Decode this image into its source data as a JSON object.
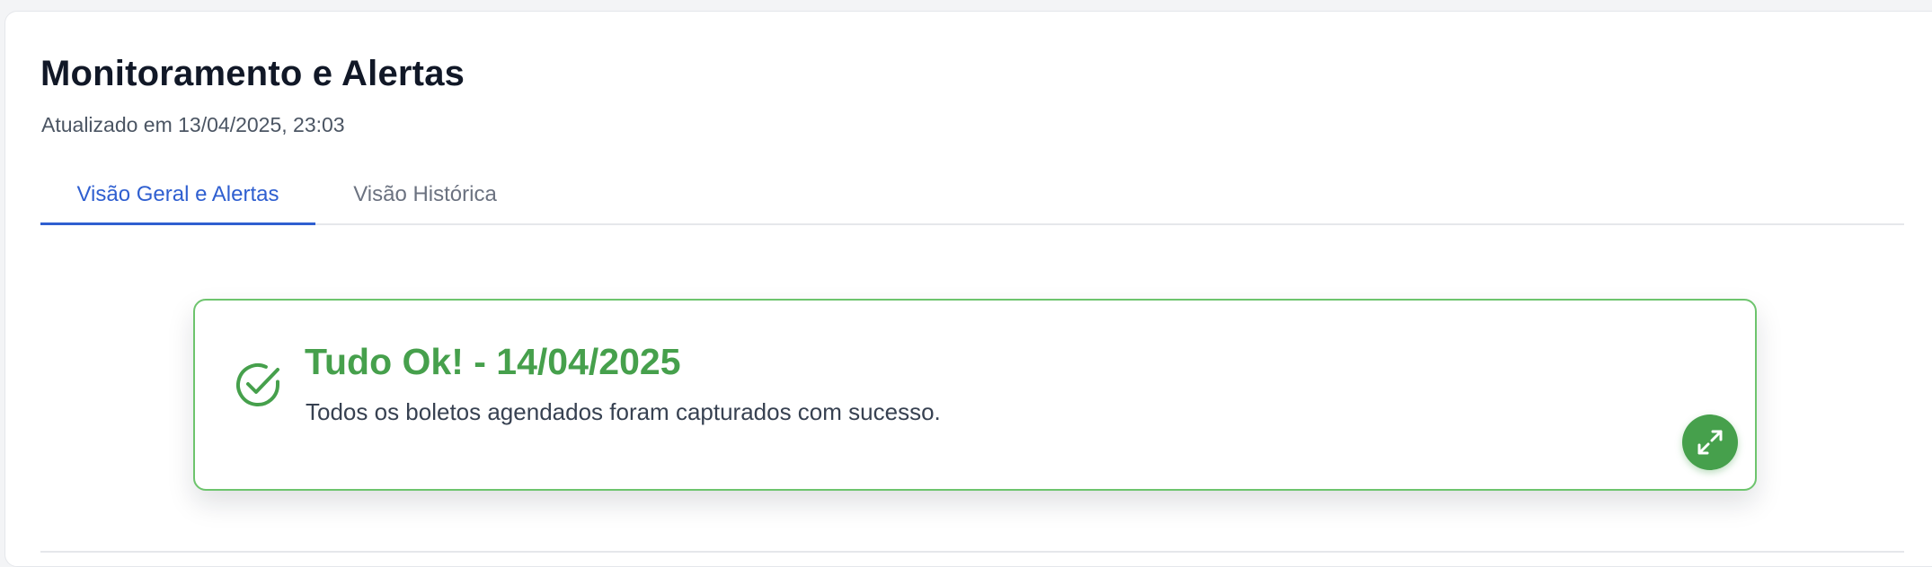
{
  "header": {
    "title": "Monitoramento e Alertas",
    "updated_at": "Atualizado em 13/04/2025, 23:03"
  },
  "tabs": [
    {
      "label": "Visão Geral e Alertas",
      "active": true
    },
    {
      "label": "Visão Histórica",
      "active": false
    }
  ],
  "alert": {
    "title": "Tudo Ok! - 14/04/2025",
    "message": "Todos os boletos agendados foram capturados com sucesso.",
    "icon": "check-circle-icon",
    "expand_icon": "expand-icon",
    "status_color": "#46a04c",
    "border_color": "#6dc46d"
  },
  "colors": {
    "accent": "#2f5fd0",
    "success": "#46a04c",
    "text_primary": "#111827",
    "text_secondary": "#4b5563"
  }
}
